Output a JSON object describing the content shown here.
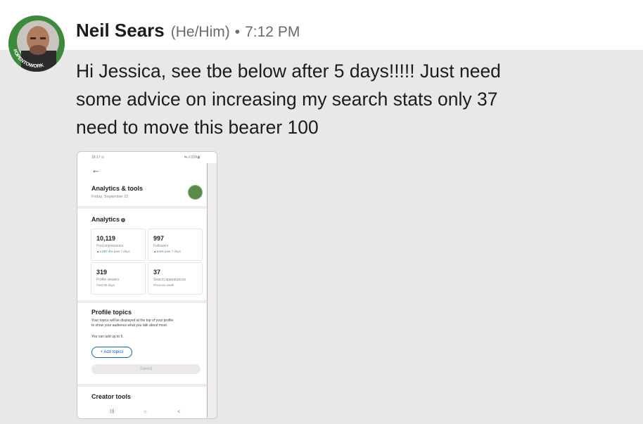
{
  "sender": {
    "name": "Neil Sears",
    "pronouns": "(He/Him)",
    "separator": "•",
    "time": "7:12 PM",
    "avatar_badge_text": "#OPENTOWORK"
  },
  "message": {
    "lines": [
      "Hi Jessica, see tbe below after 5 days!!!!! Just need",
      "some advice on increasing my search stats only 37",
      "need to move this bearer 100"
    ]
  },
  "attachment": {
    "status_left": "18:17 ⊙",
    "status_right": "⇆.ıl 20%▮",
    "back_icon": "arrow-left-icon",
    "title": "Analytics & tools",
    "date": "Friday, September 22",
    "analytics_heading": "Analytics",
    "stats": [
      {
        "value": "10,119",
        "label": "Post impressions",
        "change_value": "▲1,697.4%",
        "change_rest": " past 7 days"
      },
      {
        "value": "997",
        "label": "Followers",
        "change_value": "▲6.6%",
        "change_rest": " past 7 days"
      },
      {
        "value": "319",
        "label": "Profile viewers",
        "change_value": "",
        "change_rest": "Past 90 days"
      },
      {
        "value": "37",
        "label": "Search appearances",
        "change_value": "",
        "change_rest": "Previous week"
      }
    ],
    "profile_topics_heading": "Profile topics",
    "profile_topics_desc_1": "Your topics will be displayed at the top of your profile",
    "profile_topics_desc_2": "to show your audience what you talk about most.",
    "add_limit": "You can add up to 5.",
    "add_topics_label": "+ Add topics",
    "saved_label": "Saved",
    "creator_tools_heading": "Creator tools",
    "nav": {
      "recents": "III",
      "home": "○",
      "back": "<"
    }
  },
  "colors": {
    "background": "#e8e8e8",
    "badge_green": "#3d8a3d",
    "link_blue": "#0a66c2",
    "positive_green": "#2e8b57"
  }
}
